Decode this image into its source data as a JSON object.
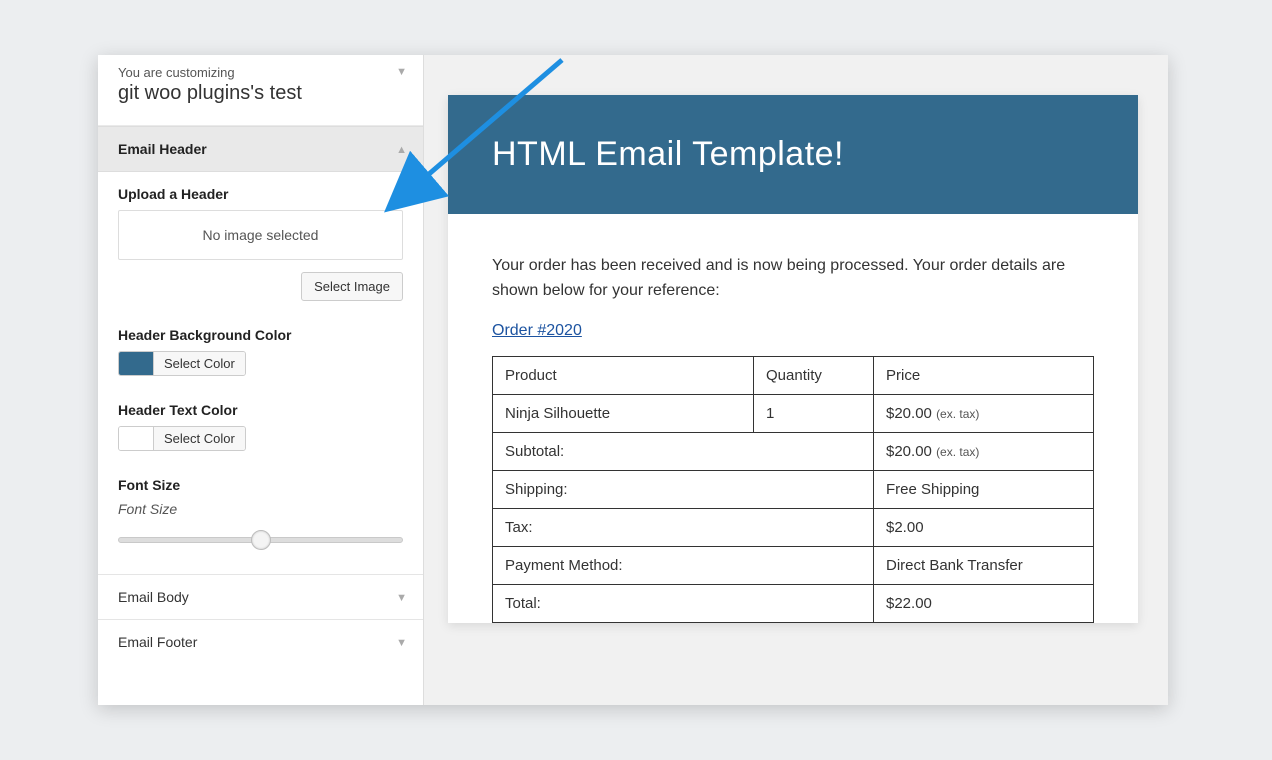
{
  "customizer": {
    "subtitle": "You are customizing",
    "title": "git woo plugins's test",
    "sections": {
      "email_header": {
        "title": "Email Header",
        "upload_label": "Upload a Header",
        "no_image": "No image selected",
        "select_image": "Select Image",
        "bg_label": "Header Background Color",
        "bg_swatch": "#336a8d",
        "select_color": "Select Color",
        "text_label": "Header Text Color",
        "text_swatch": "#ffffff",
        "font_size_label": "Font Size",
        "font_size_sub": "Font Size"
      },
      "email_body": {
        "title": "Email Body"
      },
      "email_footer": {
        "title": "Email Footer"
      }
    }
  },
  "preview": {
    "header_title": "HTML Email Template!",
    "intro": "Your order has been received and is now being processed. Your order details are shown below for your reference:",
    "order_link": "Order #2020",
    "table": {
      "headers": {
        "product": "Product",
        "qty": "Quantity",
        "price": "Price"
      },
      "item": {
        "name": "Ninja Silhouette",
        "qty": "1",
        "price": "$20.00",
        "price_note": "(ex. tax)"
      },
      "rows": {
        "subtotal_label": "Subtotal:",
        "subtotal_val": "$20.00",
        "subtotal_note": "(ex. tax)",
        "shipping_label": "Shipping:",
        "shipping_val": "Free Shipping",
        "tax_label": "Tax:",
        "tax_val": "$2.00",
        "payment_label": "Payment Method:",
        "payment_val": "Direct Bank Transfer",
        "total_label": "Total:",
        "total_val": "$22.00"
      }
    }
  }
}
